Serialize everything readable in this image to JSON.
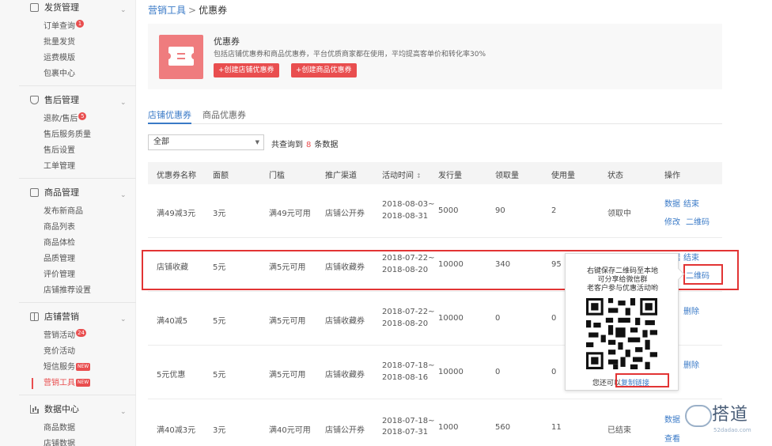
{
  "sidebar": {
    "sections": [
      {
        "title": "发货管理",
        "icon": "document-icon",
        "items": [
          "订单查询",
          "批量发货",
          "运费模版",
          "包裹中心"
        ],
        "badges": {
          "0": "1"
        }
      },
      {
        "title": "售后管理",
        "icon": "shield-icon",
        "items": [
          "退款/售后",
          "售后服务质量",
          "售后设置",
          "工单管理"
        ],
        "badges": {
          "0": "5"
        }
      },
      {
        "title": "商品管理",
        "icon": "box-icon",
        "items": [
          "发布新商品",
          "商品列表",
          "商品体检",
          "品质管理",
          "评价管理",
          "店铺推荐设置"
        ]
      },
      {
        "title": "店铺营销",
        "icon": "gift-icon",
        "items": [
          "营销活动",
          "竞价活动",
          "短信服务",
          "营销工具"
        ],
        "badges": {
          "0": "24"
        },
        "new": [
          "短信服务",
          "营销工具"
        ],
        "active": "营销工具"
      },
      {
        "title": "数据中心",
        "icon": "bar-chart-icon",
        "items": [
          "商品数据",
          "店铺数据"
        ]
      }
    ],
    "new_label": "NEW"
  },
  "breadcrumb": {
    "parent": "营销工具",
    "sep": ">",
    "current": "优惠券"
  },
  "promo": {
    "title": "优惠券",
    "desc": "包括店铺优惠券和商品优惠券，平台优质商家都在使用，平均提高客单价和转化率30%",
    "btn_shop": "+创建店铺优惠券",
    "btn_goods": "+创建商品优惠券"
  },
  "tabs": [
    "店铺优惠券",
    "商品优惠券"
  ],
  "filter": {
    "value": "全部"
  },
  "count": {
    "prefix": "共查询到",
    "num": "8",
    "suffix": "条数据"
  },
  "table": {
    "headers": [
      "优惠券名称",
      "面额",
      "门槛",
      "推广渠道",
      "活动时间",
      "发行量",
      "领取量",
      "使用量",
      "状态",
      "操作"
    ],
    "rows": [
      {
        "name": "满49减3元",
        "amount": "3元",
        "threshold": "满49元可用",
        "channel": "店铺公开券",
        "start": "2018-08-03~",
        "end": "2018-08-31",
        "issued": "5000",
        "received": "90",
        "used": "2",
        "status": "领取中",
        "ops": [
          "数据",
          "结束",
          "修改",
          "二维码"
        ]
      },
      {
        "name": "店铺收藏",
        "amount": "5元",
        "threshold": "满5元可用",
        "channel": "店铺收藏券",
        "start": "2018-07-22~",
        "end": "2018-08-20",
        "issued": "10000",
        "received": "340",
        "used": "95",
        "status": "",
        "ops": [
          "数据",
          "结束",
          "二维码"
        ]
      },
      {
        "name": "满40减5",
        "amount": "5元",
        "threshold": "满5元可用",
        "channel": "店铺收藏券",
        "start": "2018-07-22~",
        "end": "2018-08-20",
        "issued": "10000",
        "received": "0",
        "used": "0",
        "status": "",
        "ops": [
          "删除"
        ]
      },
      {
        "name": "5元优惠",
        "amount": "5元",
        "threshold": "满5元可用",
        "channel": "店铺收藏券",
        "start": "2018-07-18~",
        "end": "2018-08-16",
        "issued": "10000",
        "received": "0",
        "used": "0",
        "status": "",
        "ops": [
          "删除"
        ]
      },
      {
        "name": "满40减3元",
        "amount": "3元",
        "threshold": "满40元可用",
        "channel": "店铺公开券",
        "start": "2018-07-18~",
        "end": "2018-07-31",
        "issued": "1000",
        "received": "560",
        "used": "11",
        "status": "已结束",
        "ops": [
          "数据",
          "查看"
        ]
      }
    ]
  },
  "qr_popup": {
    "line1": "右键保存二维码至本地",
    "line2": "可分享给微信群",
    "line3": "老客户参与优惠活动哟",
    "foot_prefix": "您还可以",
    "foot_link": "复制链接"
  },
  "watermark": {
    "text": "搭道",
    "url": "52dadao.com"
  }
}
